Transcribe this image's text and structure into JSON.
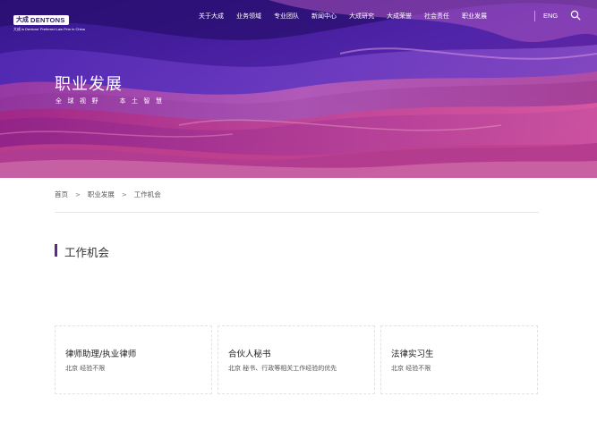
{
  "header": {
    "logo_cn": "大成",
    "logo_en": "DENTONS",
    "logo_tagline": "大成 is Dentons' Preferred Law Firm in China",
    "nav": [
      "关于大成",
      "业务领域",
      "专业团队",
      "新闻中心",
      "大成研究",
      "大成荣誉",
      "社会责任",
      "职业发展"
    ],
    "lang": "ENG"
  },
  "hero": {
    "title": "职业发展",
    "subtitle": "全球视野  本土智慧"
  },
  "breadcrumb": {
    "home": "首页",
    "parent": "职业发展",
    "current": "工作机会"
  },
  "section": {
    "title": "工作机会"
  },
  "jobs": [
    {
      "title": "律师助理/执业律师",
      "desc": "北京  经验不限"
    },
    {
      "title": "合伙人秘书",
      "desc": "北京  秘书、行政等相关工作经验的优先"
    },
    {
      "title": "法律实习生",
      "desc": "北京  经验不限"
    }
  ],
  "icons": {
    "search": "search-icon",
    "breadcrumb_separator": "chevron-right-icon"
  },
  "colors": {
    "accent": "#5b2a86",
    "hero_base": "#4a1f9e"
  }
}
